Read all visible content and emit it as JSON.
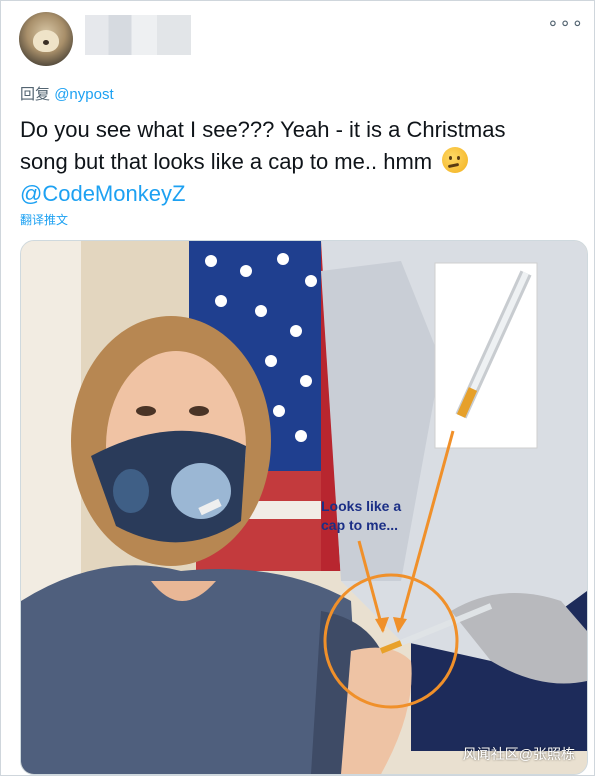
{
  "header": {
    "username_redacted": true,
    "more_icon": "more-horizontal-icon"
  },
  "reply": {
    "prefix": "回复",
    "handle": "@nypost"
  },
  "tweet": {
    "line1": "Do you see what I see???  Yeah - it is a Christmas",
    "line2": "song but that looks like a cap to me.. hmm",
    "emoji": "thinking-face-icon",
    "mention": "@CodeMonkeyZ"
  },
  "translate_label": "翻译推文",
  "media": {
    "annotation": "Looks like a cap to me...",
    "annotation_line1": "Looks like a",
    "annotation_line2": "cap to me...",
    "watermark": "风闻社区@张照栋"
  },
  "colors": {
    "link": "#1da1f2",
    "text": "#0f1419",
    "muted": "#536471",
    "annotation": "#1b2f86",
    "highlight_circle": "#f0902a"
  }
}
